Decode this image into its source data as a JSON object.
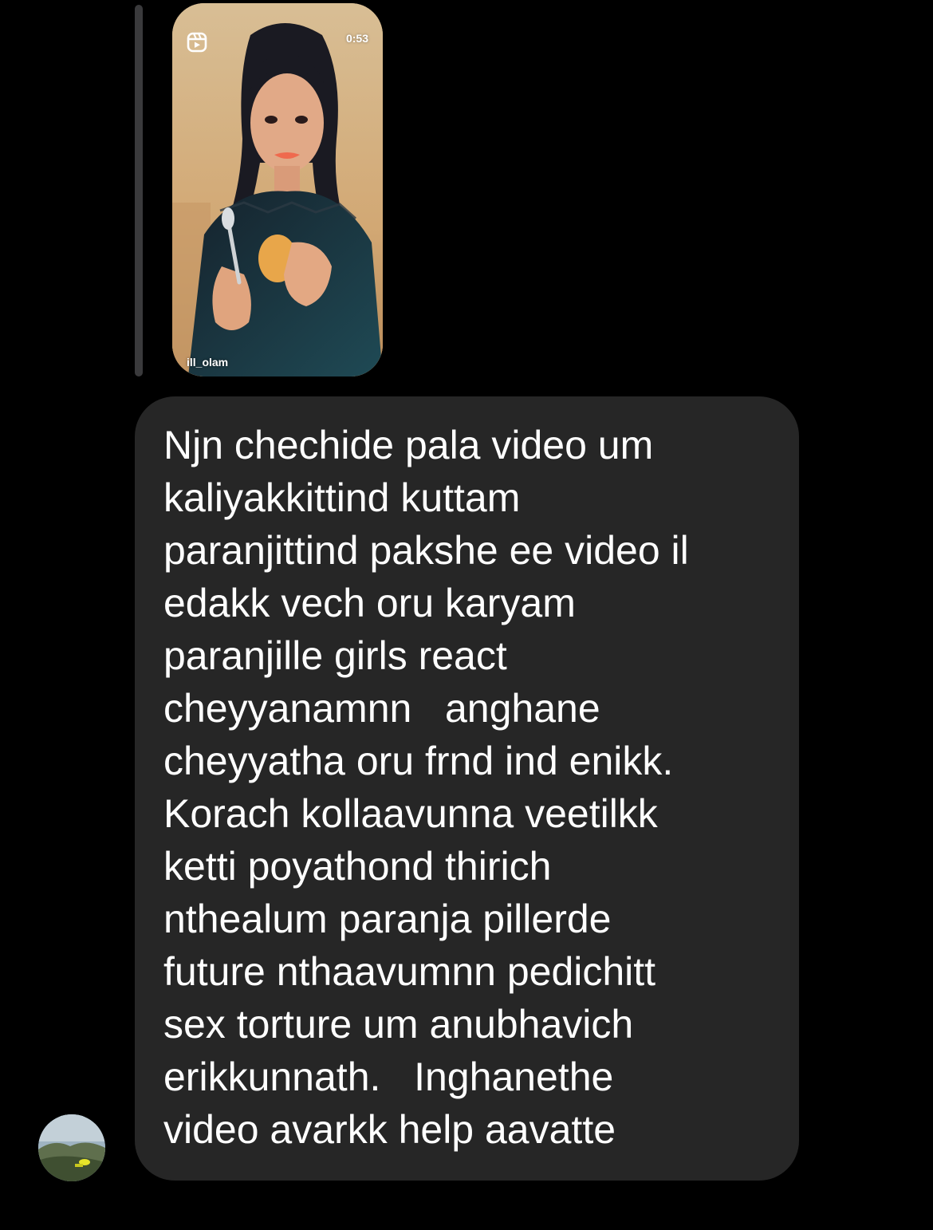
{
  "reel_preview": {
    "duration": "0:53",
    "username": "ill_olam",
    "icon": "reels-icon"
  },
  "message": {
    "text": "Njn chechide pala video um\nkaliyakkittind kuttam\nparanjittind pakshe ee video il\nedakk vech oru karyam\nparanjille girls react\ncheyyanamnn   anghane\ncheyyatha oru frnd ind enikk.\nKorach kollaavunna veetilkk\nketti poyathond thirich\nnthealum paranja pillerde\nfuture nthaavumnn pedichitt\nsex torture um anubhavich\nerikkunnath.   Inghanethe\nvideo avarkk help aavatte"
  },
  "colors": {
    "background": "#000000",
    "bubble": "#262626",
    "reply_bar": "#3a3a3c",
    "text": "#ffffff"
  }
}
